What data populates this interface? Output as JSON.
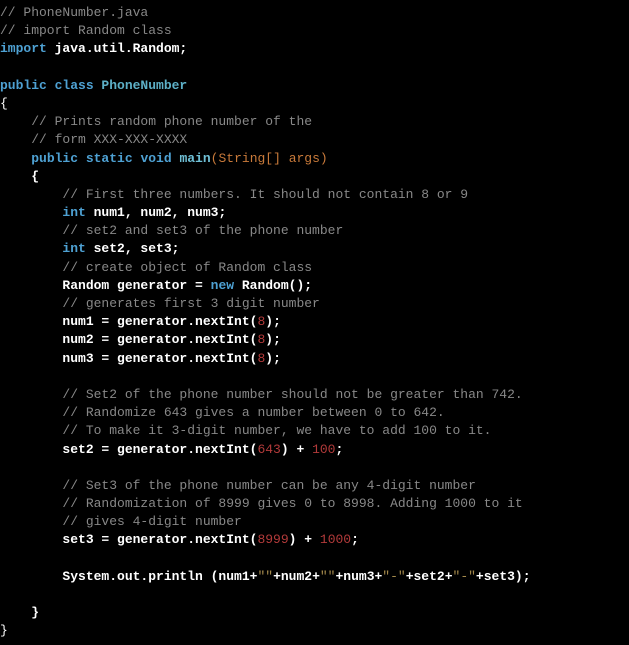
{
  "code": {
    "l1": "// PhoneNumber.java",
    "l2": "// import Random class",
    "l3a": "import",
    "l3b": " java.util.Random;",
    "l4a": "public",
    "l4b": " class ",
    "l4c": "PhoneNumber",
    "l5": "{",
    "l6": "    // Prints random phone number of the",
    "l7": "    // form XXX-XXX-XXXX",
    "l8a": "    ",
    "l8b": "public",
    "l8c": " static",
    "l8d": " void",
    "l8e": " main",
    "l8f": "(",
    "l8g": "String[] args",
    "l8h": ")",
    "l9": "    {",
    "l10": "        // First three numbers. It should not contain 8 or 9",
    "l11a": "        ",
    "l11b": "int",
    "l11c": " num1, num2, num3;",
    "l12": "        // set2 and set3 of the phone number",
    "l13a": "        ",
    "l13b": "int",
    "l13c": " set2, set3;",
    "l14": "        // create object of Random class",
    "l15a": "        Random generator = ",
    "l15b": "new",
    "l15c": " Random();",
    "l16": "        // generates first 3 digit number",
    "l17a": "        num1 = generator.nextInt(",
    "l17b": "8",
    "l17c": ");",
    "l18a": "        num2 = generator.nextInt(",
    "l18b": "8",
    "l18c": ");",
    "l19a": "        num3 = generator.nextInt(",
    "l19b": "8",
    "l19c": ");",
    "l20": "        // Set2 of the phone number should not be greater than 742.",
    "l21": "        // Randomize 643 gives a number between 0 to 642.",
    "l22": "        // To make it 3-digit number, we have to add 100 to it.",
    "l23a": "        set2 = generator.nextInt(",
    "l23b": "643",
    "l23c": ") + ",
    "l23d": "100",
    "l23e": ";",
    "l24": "        // Set3 of the phone number can be any 4-digit number",
    "l25": "        // Randomization of 8999 gives 0 to 8998. Adding 1000 to it",
    "l26": "        // gives 4-digit number",
    "l27a": "        set3 = generator.nextInt(",
    "l27b": "8999",
    "l27c": ") + ",
    "l27d": "1000",
    "l27e": ";",
    "l28a": "        System.out.println (num1+",
    "l28b": "\"\"",
    "l28c": "+num2+",
    "l28d": "\"\"",
    "l28e": "+num3+",
    "l28f": "\"-\"",
    "l28g": "+set2+",
    "l28h": "\"-\"",
    "l28i": "+set3);",
    "l29": "    }",
    "l30": "}"
  }
}
